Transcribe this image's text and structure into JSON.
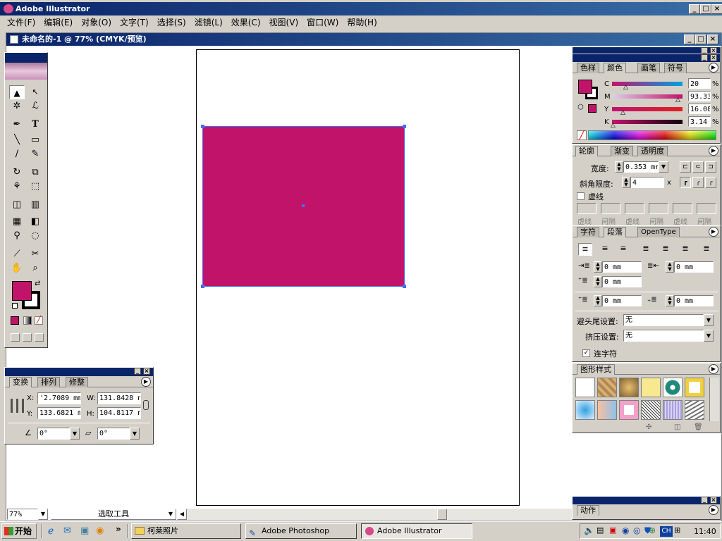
{
  "app": {
    "title": "Adobe Illustrator",
    "menu": [
      "文件(F)",
      "编辑(E)",
      "对象(O)",
      "文字(T)",
      "选择(S)",
      "滤镜(L)",
      "效果(C)",
      "视图(V)",
      "窗口(W)",
      "帮助(H)"
    ]
  },
  "document": {
    "title": "未命名的-1 @ 77% (CMYK/预览)",
    "fill_color": "#c2136b"
  },
  "transform_panel": {
    "tabs": [
      "变换",
      "排列",
      "修整"
    ],
    "x_label": "X:",
    "x_value": "'2.7089 mm",
    "y_label": "Y:",
    "y_value": "133.6821 m",
    "w_label": "W:",
    "w_value": "131.8428 n",
    "h_label": "H:",
    "h_value": "104.8117 n",
    "rotate_value": "0°",
    "shear_value": "0°"
  },
  "color_panel": {
    "tabs": [
      "色样",
      "颜色",
      "画笔",
      "符号"
    ],
    "c_label": "C",
    "c_value": "20",
    "m_label": "M",
    "m_value": "93.33",
    "y_label": "Y",
    "y_value": "16.08",
    "k_label": "K",
    "k_value": "3.14",
    "percent": "%",
    "c_level": 0.2,
    "m_level": 0.93,
    "y_level": 0.16,
    "k_level": 0.03
  },
  "stroke_panel": {
    "tabs": [
      "轮廓",
      "渐变",
      "透明度"
    ],
    "weight_label": "宽度:",
    "weight_value": "0.353 mr",
    "miter_label": "斜角限度:",
    "miter_value": "4",
    "miter_unit": "x",
    "dashed_label": "虚线",
    "dash_labels": [
      "虚线",
      "间隔",
      "虚线",
      "间隔",
      "虚线",
      "间隔"
    ]
  },
  "paragraph_panel": {
    "tabs": [
      "字符",
      "段落",
      "OpenType"
    ],
    "left_indent": "0 mm",
    "right_indent": "0 mm",
    "first_indent": "0 mm",
    "space_before": "0 mm",
    "space_after": "0 mm",
    "kinsoku_label": "避头尾设置:",
    "kinsoku_value": "无",
    "mojikumi_label": "挤压设置:",
    "mojikumi_value": "无",
    "hyphen_label": "连字符"
  },
  "graphic_styles_panel": {
    "tabs": [
      "图形样式"
    ]
  },
  "actions_panel": {
    "tabs": [
      "动作"
    ]
  },
  "status_bar": {
    "zoom": "77%",
    "tool": "选取工具"
  },
  "taskbar": {
    "start": "开始",
    "chevron": "»",
    "tasks": [
      "柯莱照片",
      "Adobe Photoshop",
      "Adobe Illustrator"
    ],
    "ime": "CH",
    "clock": "11:40"
  }
}
